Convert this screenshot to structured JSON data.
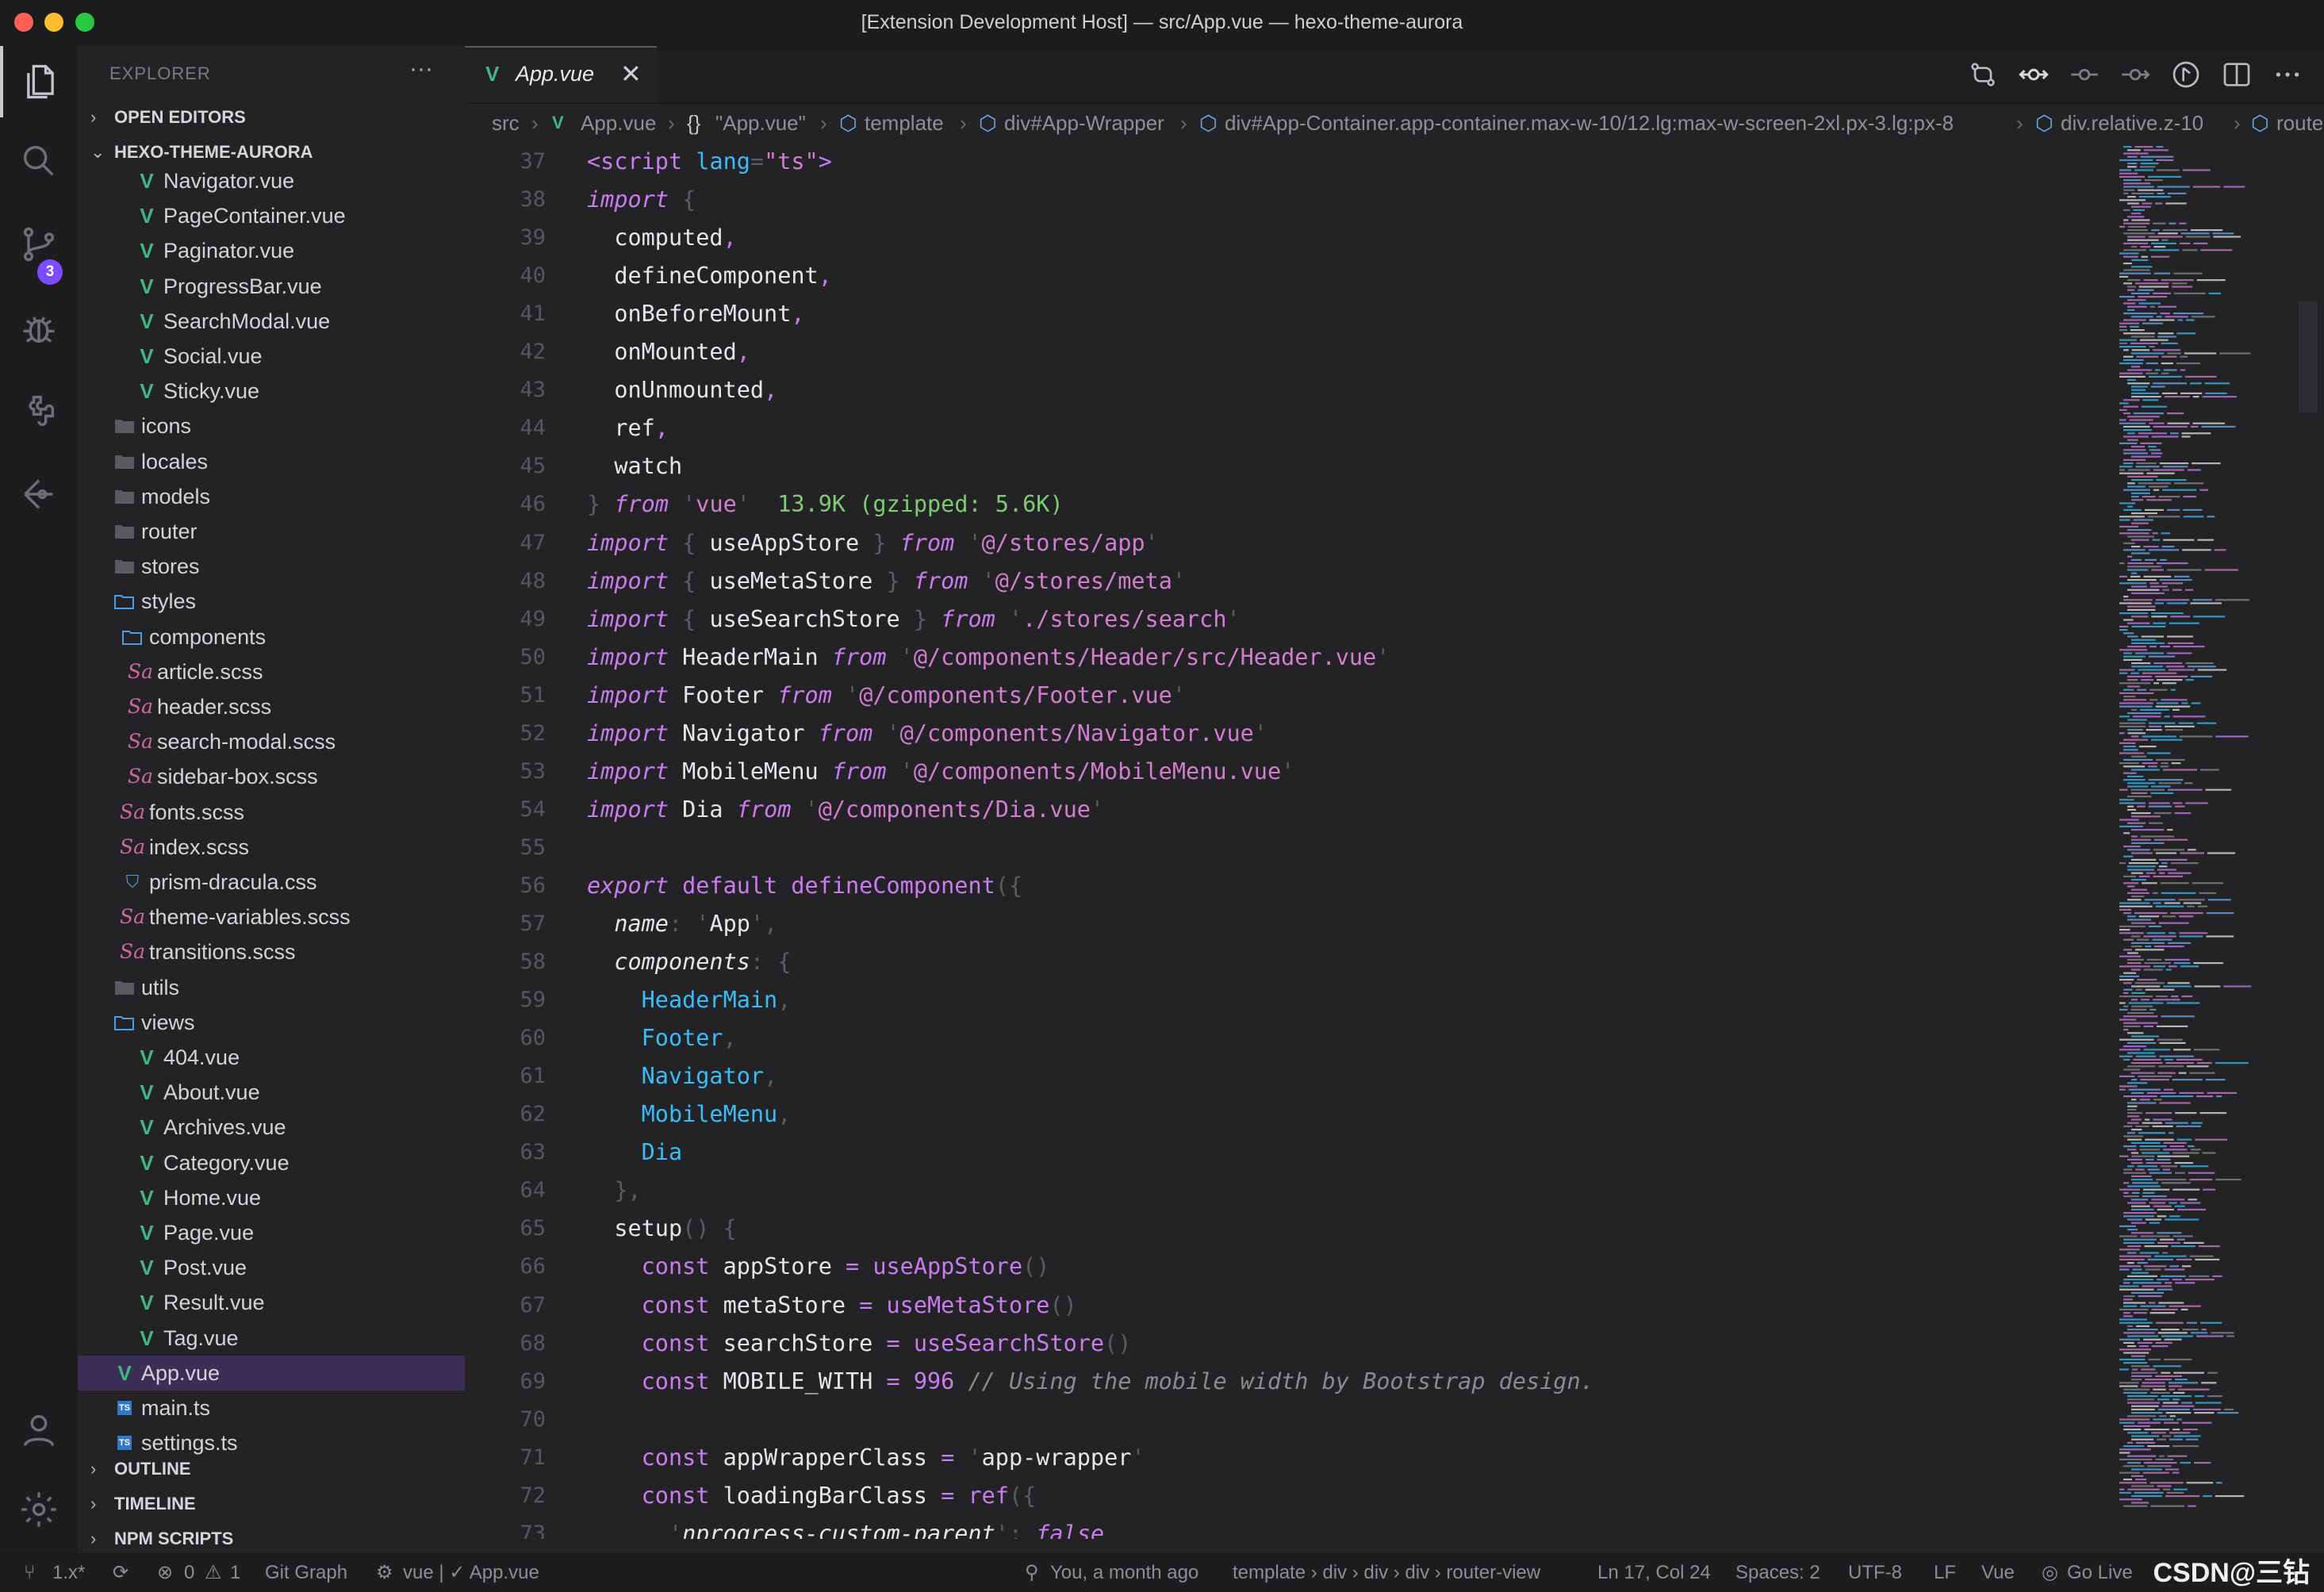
{
  "window": {
    "title": "[Extension Development Host] — src/App.vue — hexo-theme-aurora"
  },
  "activity_bar": {
    "items": [
      "files-icon",
      "search-icon",
      "source-control-icon",
      "debug-icon",
      "extensions-icon",
      "gitlens-icon"
    ],
    "scm_badge": "3",
    "bottom_items": [
      "account-icon",
      "settings-gear-icon"
    ]
  },
  "sidebar": {
    "title": "EXPLORER",
    "more": "···",
    "sections": {
      "open_editors": "OPEN EDITORS",
      "project": "HEXO-THEME-AURORA",
      "outline": "OUTLINE",
      "timeline": "TIMELINE",
      "npm_scripts": "NPM SCRIPTS"
    },
    "tree": [
      {
        "name": "Navigator.vue",
        "type": "vue"
      },
      {
        "name": "PageContainer.vue",
        "type": "vue"
      },
      {
        "name": "Paginator.vue",
        "type": "vue"
      },
      {
        "name": "ProgressBar.vue",
        "type": "vue"
      },
      {
        "name": "SearchModal.vue",
        "type": "vue"
      },
      {
        "name": "Social.vue",
        "type": "vue"
      },
      {
        "name": "Sticky.vue",
        "type": "vue"
      },
      {
        "name": "icons",
        "type": "folder"
      },
      {
        "name": "locales",
        "type": "folder"
      },
      {
        "name": "models",
        "type": "folder"
      },
      {
        "name": "router",
        "type": "folder"
      },
      {
        "name": "stores",
        "type": "folder"
      },
      {
        "name": "styles",
        "type": "folder-open"
      },
      {
        "name": "components",
        "type": "folder-open"
      },
      {
        "name": "article.scss",
        "type": "sass"
      },
      {
        "name": "header.scss",
        "type": "sass"
      },
      {
        "name": "search-modal.scss",
        "type": "sass"
      },
      {
        "name": "sidebar-box.scss",
        "type": "sass"
      },
      {
        "name": "fonts.scss",
        "type": "sass"
      },
      {
        "name": "index.scss",
        "type": "sass"
      },
      {
        "name": "prism-dracula.css",
        "type": "css"
      },
      {
        "name": "theme-variables.scss",
        "type": "sass"
      },
      {
        "name": "transitions.scss",
        "type": "sass"
      },
      {
        "name": "utils",
        "type": "folder"
      },
      {
        "name": "views",
        "type": "folder-open"
      },
      {
        "name": "404.vue",
        "type": "vue"
      },
      {
        "name": "About.vue",
        "type": "vue"
      },
      {
        "name": "Archives.vue",
        "type": "vue"
      },
      {
        "name": "Category.vue",
        "type": "vue"
      },
      {
        "name": "Home.vue",
        "type": "vue"
      },
      {
        "name": "Page.vue",
        "type": "vue"
      },
      {
        "name": "Post.vue",
        "type": "vue"
      },
      {
        "name": "Result.vue",
        "type": "vue"
      },
      {
        "name": "Tag.vue",
        "type": "vue"
      },
      {
        "name": "App.vue",
        "type": "vue",
        "selected": true
      },
      {
        "name": "main.ts",
        "type": "ts"
      },
      {
        "name": "settings.ts",
        "type": "ts"
      }
    ]
  },
  "editor": {
    "tab": {
      "label": "App.vue",
      "close": "✕"
    },
    "toolbar_icons": [
      "compare-changes-icon",
      "git-commit-icon",
      "previous-change-icon",
      "next-change-icon",
      "open-changes-icon",
      "split-editor-icon",
      "more-actions-icon"
    ],
    "breadcrumbs": [
      "src",
      "App.vue",
      "\"App.vue\"",
      "template",
      "div#App-Wrapper",
      "div#App-Container.app-container.max-w-10/12.lg:max-w-screen-2xl.px-3.lg:px-8",
      "div.relative.z-10",
      "route"
    ],
    "import_cost": "13.9K (gzipped: 5.6K)",
    "code_lines": [
      {
        "n": "37",
        "segs": [
          [
            "tag",
            "<script "
          ],
          [
            "attr",
            "lang"
          ],
          [
            "p",
            "="
          ],
          [
            "s",
            "\"ts\""
          ],
          [
            "tag",
            ">"
          ]
        ]
      },
      {
        "n": "38",
        "segs": [
          [
            "k",
            "import "
          ],
          [
            "p",
            "{"
          ]
        ]
      },
      {
        "n": "39",
        "segs": [
          [
            "x",
            "  computed"
          ],
          [
            "kw",
            ","
          ]
        ]
      },
      {
        "n": "40",
        "segs": [
          [
            "x",
            "  defineComponent"
          ],
          [
            "kw",
            ","
          ]
        ]
      },
      {
        "n": "41",
        "segs": [
          [
            "x",
            "  onBeforeMount"
          ],
          [
            "kw",
            ","
          ]
        ]
      },
      {
        "n": "42",
        "segs": [
          [
            "x",
            "  onMounted"
          ],
          [
            "kw",
            ","
          ]
        ]
      },
      {
        "n": "43",
        "segs": [
          [
            "x",
            "  onUnmounted"
          ],
          [
            "kw",
            ","
          ]
        ]
      },
      {
        "n": "44",
        "segs": [
          [
            "x",
            "  ref"
          ],
          [
            "kw",
            ","
          ]
        ]
      },
      {
        "n": "45",
        "segs": [
          [
            "x",
            "  watch"
          ]
        ]
      },
      {
        "n": "46",
        "segs": [
          [
            "p",
            "} "
          ],
          [
            "f",
            "from "
          ],
          [
            "q",
            "'"
          ],
          [
            "s",
            "vue"
          ],
          [
            "q",
            "'"
          ],
          [
            "g",
            "  13.9K (gzipped: 5.6K)"
          ]
        ]
      },
      {
        "n": "47",
        "segs": [
          [
            "k",
            "import "
          ],
          [
            "p",
            "{ "
          ],
          [
            "x",
            "useAppStore "
          ],
          [
            "p",
            "} "
          ],
          [
            "f",
            "from "
          ],
          [
            "q",
            "'"
          ],
          [
            "s",
            "@/stores/app"
          ],
          [
            "q",
            "'"
          ]
        ]
      },
      {
        "n": "48",
        "segs": [
          [
            "k",
            "import "
          ],
          [
            "p",
            "{ "
          ],
          [
            "x",
            "useMetaStore "
          ],
          [
            "p",
            "} "
          ],
          [
            "f",
            "from "
          ],
          [
            "q",
            "'"
          ],
          [
            "s",
            "@/stores/meta"
          ],
          [
            "q",
            "'"
          ]
        ]
      },
      {
        "n": "49",
        "segs": [
          [
            "k",
            "import "
          ],
          [
            "p",
            "{ "
          ],
          [
            "x",
            "useSearchStore "
          ],
          [
            "p",
            "} "
          ],
          [
            "f",
            "from "
          ],
          [
            "q",
            "'"
          ],
          [
            "s",
            "./stores/search"
          ],
          [
            "q",
            "'"
          ]
        ]
      },
      {
        "n": "50",
        "segs": [
          [
            "k",
            "import "
          ],
          [
            "x",
            "HeaderMain "
          ],
          [
            "f",
            "from "
          ],
          [
            "q",
            "'"
          ],
          [
            "s",
            "@/components/Header/src/Header.vue"
          ],
          [
            "q",
            "'"
          ]
        ]
      },
      {
        "n": "51",
        "segs": [
          [
            "k",
            "import "
          ],
          [
            "x",
            "Footer "
          ],
          [
            "f",
            "from "
          ],
          [
            "q",
            "'"
          ],
          [
            "s",
            "@/components/Footer.vue"
          ],
          [
            "q",
            "'"
          ]
        ]
      },
      {
        "n": "52",
        "segs": [
          [
            "k",
            "import "
          ],
          [
            "x",
            "Navigator "
          ],
          [
            "f",
            "from "
          ],
          [
            "q",
            "'"
          ],
          [
            "s",
            "@/components/Navigator.vue"
          ],
          [
            "q",
            "'"
          ]
        ]
      },
      {
        "n": "53",
        "segs": [
          [
            "k",
            "import "
          ],
          [
            "x",
            "MobileMenu "
          ],
          [
            "f",
            "from "
          ],
          [
            "q",
            "'"
          ],
          [
            "s",
            "@/components/MobileMenu.vue"
          ],
          [
            "q",
            "'"
          ]
        ]
      },
      {
        "n": "54",
        "segs": [
          [
            "k",
            "import "
          ],
          [
            "x",
            "Dia "
          ],
          [
            "f",
            "from "
          ],
          [
            "q",
            "'"
          ],
          [
            "s",
            "@/components/Dia.vue"
          ],
          [
            "q",
            "'"
          ]
        ]
      },
      {
        "n": "55",
        "segs": []
      },
      {
        "n": "56",
        "segs": [
          [
            "k",
            "export "
          ],
          [
            "kw",
            "default "
          ],
          [
            "fn",
            "defineComponent"
          ],
          [
            "p",
            "({"
          ]
        ]
      },
      {
        "n": "57",
        "segs": [
          [
            "prop",
            "  name"
          ],
          [
            "p",
            ": "
          ],
          [
            "q",
            "'"
          ],
          [
            "x",
            "App"
          ],
          [
            "q",
            "'"
          ],
          [
            "p",
            ","
          ]
        ]
      },
      {
        "n": "58",
        "segs": [
          [
            "prop",
            "  components"
          ],
          [
            "p",
            ": {"
          ]
        ]
      },
      {
        "n": "59",
        "segs": [
          [
            "t",
            "    HeaderMain"
          ],
          [
            "p",
            ","
          ]
        ]
      },
      {
        "n": "60",
        "segs": [
          [
            "t",
            "    Footer"
          ],
          [
            "p",
            ","
          ]
        ]
      },
      {
        "n": "61",
        "segs": [
          [
            "t",
            "    Navigator"
          ],
          [
            "p",
            ","
          ]
        ]
      },
      {
        "n": "62",
        "segs": [
          [
            "t",
            "    MobileMenu"
          ],
          [
            "p",
            ","
          ]
        ]
      },
      {
        "n": "63",
        "segs": [
          [
            "t",
            "    Dia"
          ]
        ]
      },
      {
        "n": "64",
        "segs": [
          [
            "p",
            "  },"
          ]
        ]
      },
      {
        "n": "65",
        "segs": [
          [
            "x",
            "  setup"
          ],
          [
            "p",
            "() {"
          ]
        ]
      },
      {
        "n": "66",
        "segs": [
          [
            "kw",
            "    const "
          ],
          [
            "x",
            "appStore "
          ],
          [
            "kw",
            "= "
          ],
          [
            "fn",
            "useAppStore"
          ],
          [
            "p",
            "()"
          ]
        ]
      },
      {
        "n": "67",
        "segs": [
          [
            "kw",
            "    const "
          ],
          [
            "x",
            "metaStore "
          ],
          [
            "kw",
            "= "
          ],
          [
            "fn",
            "useMetaStore"
          ],
          [
            "p",
            "()"
          ]
        ]
      },
      {
        "n": "68",
        "segs": [
          [
            "kw",
            "    const "
          ],
          [
            "x",
            "searchStore "
          ],
          [
            "kw",
            "= "
          ],
          [
            "fn",
            "useSearchStore"
          ],
          [
            "p",
            "()"
          ]
        ]
      },
      {
        "n": "69",
        "segs": [
          [
            "kw",
            "    const "
          ],
          [
            "x",
            "MOBILE_WITH "
          ],
          [
            "kw",
            "= "
          ],
          [
            "n",
            "996 "
          ],
          [
            "c",
            "// Using the mobile width by Bootstrap design."
          ]
        ]
      },
      {
        "n": "70",
        "segs": []
      },
      {
        "n": "71",
        "segs": [
          [
            "kw",
            "    const "
          ],
          [
            "x",
            "appWrapperClass "
          ],
          [
            "kw",
            "= "
          ],
          [
            "q",
            "'"
          ],
          [
            "x",
            "app-wrapper"
          ],
          [
            "q",
            "'"
          ]
        ]
      },
      {
        "n": "72",
        "segs": [
          [
            "kw",
            "    const "
          ],
          [
            "x",
            "loadingBarClass "
          ],
          [
            "kw",
            "= "
          ],
          [
            "fn",
            "ref"
          ],
          [
            "p",
            "({"
          ]
        ]
      },
      {
        "n": "73",
        "segs": [
          [
            "q",
            "      '"
          ],
          [
            "prop",
            "nprogress-custom-parent"
          ],
          [
            "q",
            "'"
          ],
          [
            "p",
            ": "
          ],
          [
            "k",
            "false"
          ]
        ]
      }
    ]
  },
  "status_bar": {
    "branch": "1.x*",
    "sync": "⟳",
    "errors": "0",
    "warnings": "1",
    "git_graph": "Git Graph",
    "vue_lang": "vue | ✓ App.vue",
    "blame": "You, a month ago",
    "path": "template › div › div › div › router-view",
    "position": "Ln 17, Col 24",
    "spaces": "Spaces: 2",
    "encoding": "UTF-8",
    "eol": "LF",
    "language": "Vue",
    "go_live": "Go Live"
  },
  "watermark": "CSDN@三钻"
}
